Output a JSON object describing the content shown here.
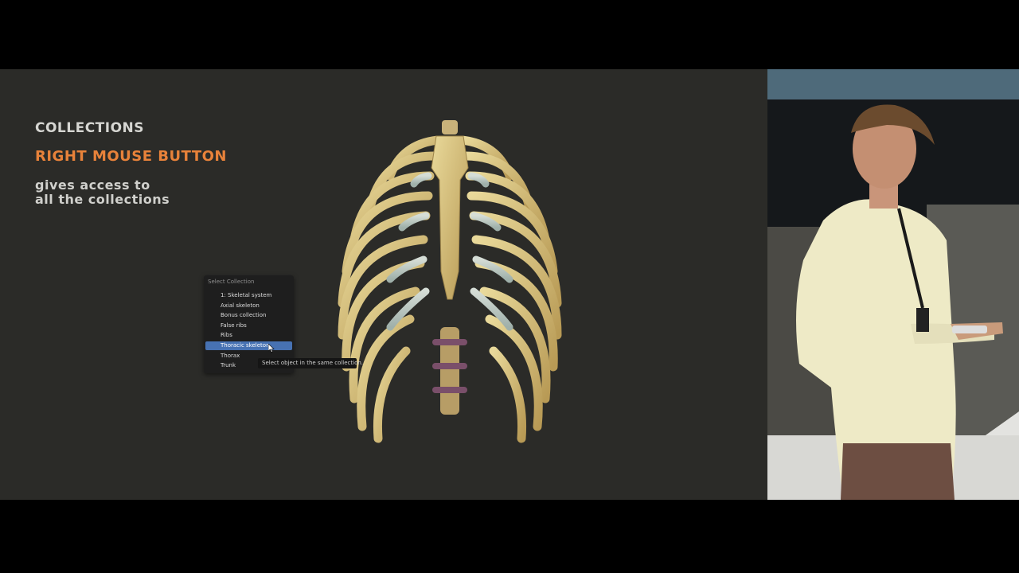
{
  "slide": {
    "heading_collections": "COLLECTIONS",
    "heading_rmb": "RIGHT MOUSE BUTTON",
    "desc_line1": "gives access to",
    "desc_line2": "all the collections",
    "accent_color": "#e8823a"
  },
  "menu": {
    "title": "Select Collection",
    "items": [
      {
        "label": "1: Skeletal system"
      },
      {
        "label": "Axial skeleton"
      },
      {
        "label": "Bonus collection"
      },
      {
        "label": "False ribs"
      },
      {
        "label": "Ribs"
      },
      {
        "label": "Thoracic skeleton",
        "active": true
      },
      {
        "label": "Thorax"
      },
      {
        "label": "Trunk"
      }
    ],
    "active_color": "#4772b3",
    "tooltip": "Select object in the same collection."
  }
}
